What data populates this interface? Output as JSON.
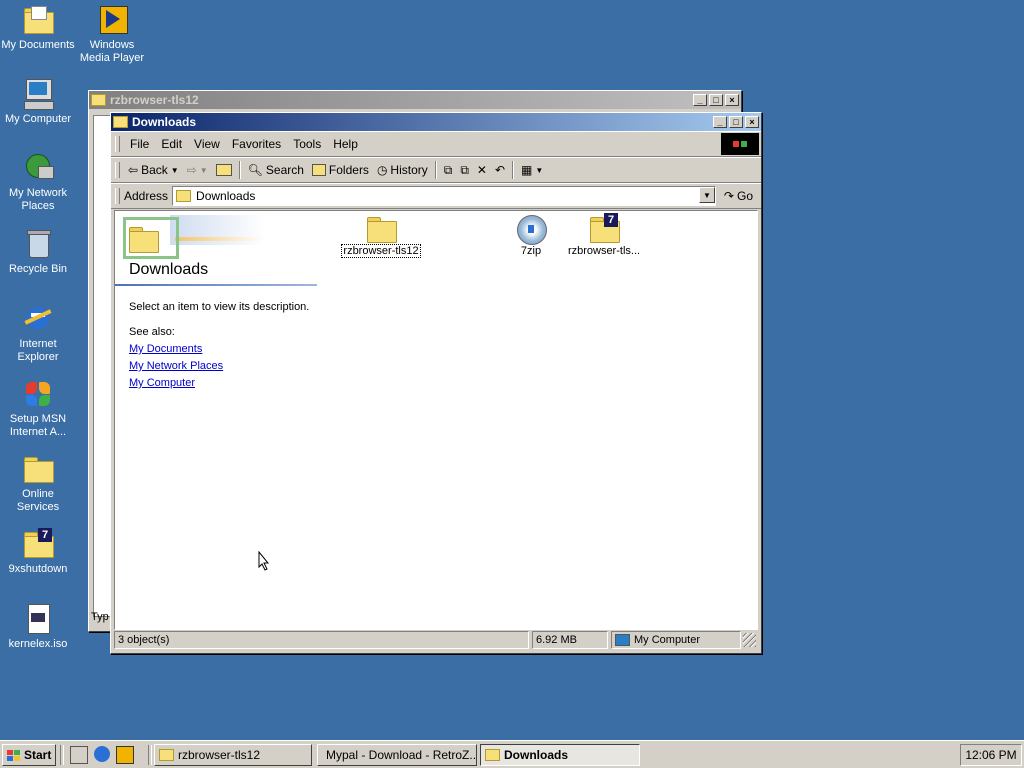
{
  "desktop": {
    "icons": [
      {
        "label": "My Documents"
      },
      {
        "label": "Windows Media Player"
      },
      {
        "label": "My Computer"
      },
      {
        "label": "My Network Places"
      },
      {
        "label": "Recycle Bin"
      },
      {
        "label": "Internet Explorer"
      },
      {
        "label": "Setup MSN Internet A..."
      },
      {
        "label": "Online Services"
      },
      {
        "label": "9xshutdown"
      },
      {
        "label": "kernelex.iso"
      }
    ]
  },
  "back_window": {
    "title": "rzbrowser-tls12",
    "status_fragment": "Typ"
  },
  "window": {
    "title": "Downloads",
    "menu": [
      "File",
      "Edit",
      "View",
      "Favorites",
      "Tools",
      "Help"
    ],
    "toolbar": {
      "back": "Back",
      "search": "Search",
      "folders": "Folders",
      "history": "History"
    },
    "address": {
      "label": "Address",
      "value": "Downloads",
      "go": "Go"
    },
    "webview": {
      "folder_name": "Downloads",
      "description": "Select an item to view its description.",
      "see_also_label": "See also:",
      "links": [
        "My Documents",
        "My Network Places",
        "My Computer"
      ]
    },
    "files": [
      {
        "name": "rzbrowser-tls12",
        "icon": "folder-icon",
        "selected": true
      },
      {
        "name": "7zip",
        "icon": "installer-disc-icon"
      },
      {
        "name": "rzbrowser-tls...",
        "icon": "7zip-folder-icon"
      }
    ],
    "status": {
      "count": "3 object(s)",
      "size": "6.92 MB",
      "zone": "My Computer"
    }
  },
  "taskbar": {
    "start": "Start",
    "tasks": [
      {
        "label": "rzbrowser-tls12"
      },
      {
        "label": "Mypal - Download - RetroZ..."
      },
      {
        "label": "Downloads",
        "active": true
      }
    ],
    "clock": "12:06 PM"
  },
  "colors": {
    "desktop": "#3a6ea5",
    "title_active": "#0a246a",
    "link": "#0000cc"
  }
}
